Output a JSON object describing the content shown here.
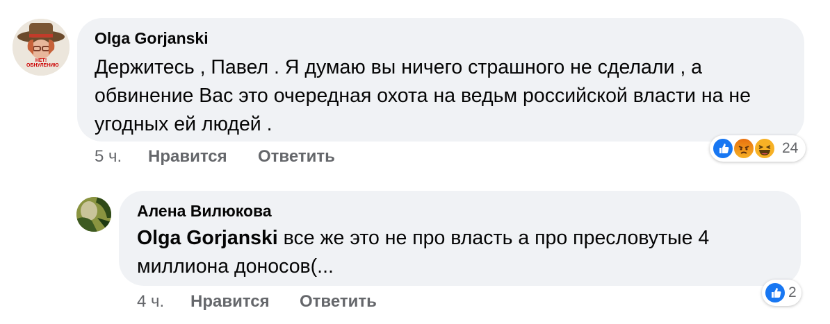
{
  "comments": [
    {
      "author": "Olga Gorjanski",
      "avatar_text": "НЕТ! ОБНУЛЕНИЮ",
      "text": "Держитесь , Павел . Я думаю вы ничего страшного не сделали , а обвинение Вас это очередная охота на ведьм российской власти на не угодных ей людей .",
      "time": "5 ч.",
      "like_label": "Нравится",
      "reply_label": "Ответить",
      "reactions": [
        "like",
        "angry",
        "haha"
      ],
      "reaction_count": "24"
    }
  ],
  "reply": {
    "author": "Алена Вилюкова",
    "mention": "Olga Gorjanski",
    "text": " все же это не про власть а про пресловутые 4 миллиона доносов(...",
    "time": "4 ч.",
    "like_label": "Нравится",
    "reply_label": "Ответить",
    "reactions": [
      "like"
    ],
    "reaction_count": "2"
  },
  "colors": {
    "bubble": "#f0f2f5",
    "secondary_text": "#65676b",
    "like_blue": "#1877f2",
    "angry": "#e9710f",
    "haha": "#f7b125"
  }
}
